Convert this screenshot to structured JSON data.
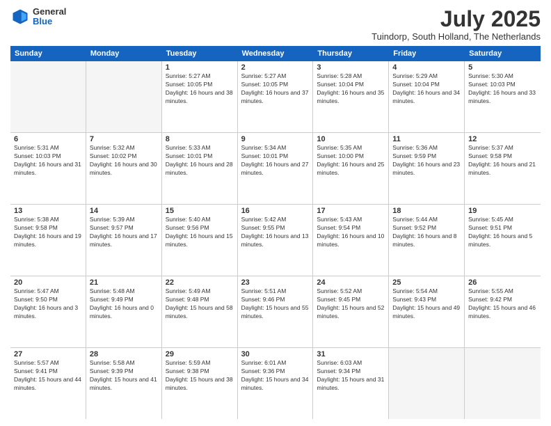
{
  "logo": {
    "general": "General",
    "blue": "Blue"
  },
  "title": "July 2025",
  "location": "Tuindorp, South Holland, The Netherlands",
  "header": {
    "days": [
      "Sunday",
      "Monday",
      "Tuesday",
      "Wednesday",
      "Thursday",
      "Friday",
      "Saturday"
    ]
  },
  "weeks": [
    [
      {
        "day": "",
        "sunrise": "",
        "sunset": "",
        "daylight": "",
        "empty": true
      },
      {
        "day": "",
        "sunrise": "",
        "sunset": "",
        "daylight": "",
        "empty": true
      },
      {
        "day": "1",
        "sunrise": "Sunrise: 5:27 AM",
        "sunset": "Sunset: 10:05 PM",
        "daylight": "Daylight: 16 hours and 38 minutes."
      },
      {
        "day": "2",
        "sunrise": "Sunrise: 5:27 AM",
        "sunset": "Sunset: 10:05 PM",
        "daylight": "Daylight: 16 hours and 37 minutes."
      },
      {
        "day": "3",
        "sunrise": "Sunrise: 5:28 AM",
        "sunset": "Sunset: 10:04 PM",
        "daylight": "Daylight: 16 hours and 35 minutes."
      },
      {
        "day": "4",
        "sunrise": "Sunrise: 5:29 AM",
        "sunset": "Sunset: 10:04 PM",
        "daylight": "Daylight: 16 hours and 34 minutes."
      },
      {
        "day": "5",
        "sunrise": "Sunrise: 5:30 AM",
        "sunset": "Sunset: 10:03 PM",
        "daylight": "Daylight: 16 hours and 33 minutes."
      }
    ],
    [
      {
        "day": "6",
        "sunrise": "Sunrise: 5:31 AM",
        "sunset": "Sunset: 10:03 PM",
        "daylight": "Daylight: 16 hours and 31 minutes."
      },
      {
        "day": "7",
        "sunrise": "Sunrise: 5:32 AM",
        "sunset": "Sunset: 10:02 PM",
        "daylight": "Daylight: 16 hours and 30 minutes."
      },
      {
        "day": "8",
        "sunrise": "Sunrise: 5:33 AM",
        "sunset": "Sunset: 10:01 PM",
        "daylight": "Daylight: 16 hours and 28 minutes."
      },
      {
        "day": "9",
        "sunrise": "Sunrise: 5:34 AM",
        "sunset": "Sunset: 10:01 PM",
        "daylight": "Daylight: 16 hours and 27 minutes."
      },
      {
        "day": "10",
        "sunrise": "Sunrise: 5:35 AM",
        "sunset": "Sunset: 10:00 PM",
        "daylight": "Daylight: 16 hours and 25 minutes."
      },
      {
        "day": "11",
        "sunrise": "Sunrise: 5:36 AM",
        "sunset": "Sunset: 9:59 PM",
        "daylight": "Daylight: 16 hours and 23 minutes."
      },
      {
        "day": "12",
        "sunrise": "Sunrise: 5:37 AM",
        "sunset": "Sunset: 9:58 PM",
        "daylight": "Daylight: 16 hours and 21 minutes."
      }
    ],
    [
      {
        "day": "13",
        "sunrise": "Sunrise: 5:38 AM",
        "sunset": "Sunset: 9:58 PM",
        "daylight": "Daylight: 16 hours and 19 minutes."
      },
      {
        "day": "14",
        "sunrise": "Sunrise: 5:39 AM",
        "sunset": "Sunset: 9:57 PM",
        "daylight": "Daylight: 16 hours and 17 minutes."
      },
      {
        "day": "15",
        "sunrise": "Sunrise: 5:40 AM",
        "sunset": "Sunset: 9:56 PM",
        "daylight": "Daylight: 16 hours and 15 minutes."
      },
      {
        "day": "16",
        "sunrise": "Sunrise: 5:42 AM",
        "sunset": "Sunset: 9:55 PM",
        "daylight": "Daylight: 16 hours and 13 minutes."
      },
      {
        "day": "17",
        "sunrise": "Sunrise: 5:43 AM",
        "sunset": "Sunset: 9:54 PM",
        "daylight": "Daylight: 16 hours and 10 minutes."
      },
      {
        "day": "18",
        "sunrise": "Sunrise: 5:44 AM",
        "sunset": "Sunset: 9:52 PM",
        "daylight": "Daylight: 16 hours and 8 minutes."
      },
      {
        "day": "19",
        "sunrise": "Sunrise: 5:45 AM",
        "sunset": "Sunset: 9:51 PM",
        "daylight": "Daylight: 16 hours and 5 minutes."
      }
    ],
    [
      {
        "day": "20",
        "sunrise": "Sunrise: 5:47 AM",
        "sunset": "Sunset: 9:50 PM",
        "daylight": "Daylight: 16 hours and 3 minutes."
      },
      {
        "day": "21",
        "sunrise": "Sunrise: 5:48 AM",
        "sunset": "Sunset: 9:49 PM",
        "daylight": "Daylight: 16 hours and 0 minutes."
      },
      {
        "day": "22",
        "sunrise": "Sunrise: 5:49 AM",
        "sunset": "Sunset: 9:48 PM",
        "daylight": "Daylight: 15 hours and 58 minutes."
      },
      {
        "day": "23",
        "sunrise": "Sunrise: 5:51 AM",
        "sunset": "Sunset: 9:46 PM",
        "daylight": "Daylight: 15 hours and 55 minutes."
      },
      {
        "day": "24",
        "sunrise": "Sunrise: 5:52 AM",
        "sunset": "Sunset: 9:45 PM",
        "daylight": "Daylight: 15 hours and 52 minutes."
      },
      {
        "day": "25",
        "sunrise": "Sunrise: 5:54 AM",
        "sunset": "Sunset: 9:43 PM",
        "daylight": "Daylight: 15 hours and 49 minutes."
      },
      {
        "day": "26",
        "sunrise": "Sunrise: 5:55 AM",
        "sunset": "Sunset: 9:42 PM",
        "daylight": "Daylight: 15 hours and 46 minutes."
      }
    ],
    [
      {
        "day": "27",
        "sunrise": "Sunrise: 5:57 AM",
        "sunset": "Sunset: 9:41 PM",
        "daylight": "Daylight: 15 hours and 44 minutes."
      },
      {
        "day": "28",
        "sunrise": "Sunrise: 5:58 AM",
        "sunset": "Sunset: 9:39 PM",
        "daylight": "Daylight: 15 hours and 41 minutes."
      },
      {
        "day": "29",
        "sunrise": "Sunrise: 5:59 AM",
        "sunset": "Sunset: 9:38 PM",
        "daylight": "Daylight: 15 hours and 38 minutes."
      },
      {
        "day": "30",
        "sunrise": "Sunrise: 6:01 AM",
        "sunset": "Sunset: 9:36 PM",
        "daylight": "Daylight: 15 hours and 34 minutes."
      },
      {
        "day": "31",
        "sunrise": "Sunrise: 6:03 AM",
        "sunset": "Sunset: 9:34 PM",
        "daylight": "Daylight: 15 hours and 31 minutes."
      },
      {
        "day": "",
        "sunrise": "",
        "sunset": "",
        "daylight": "",
        "empty": true
      },
      {
        "day": "",
        "sunrise": "",
        "sunset": "",
        "daylight": "",
        "empty": true
      }
    ]
  ]
}
